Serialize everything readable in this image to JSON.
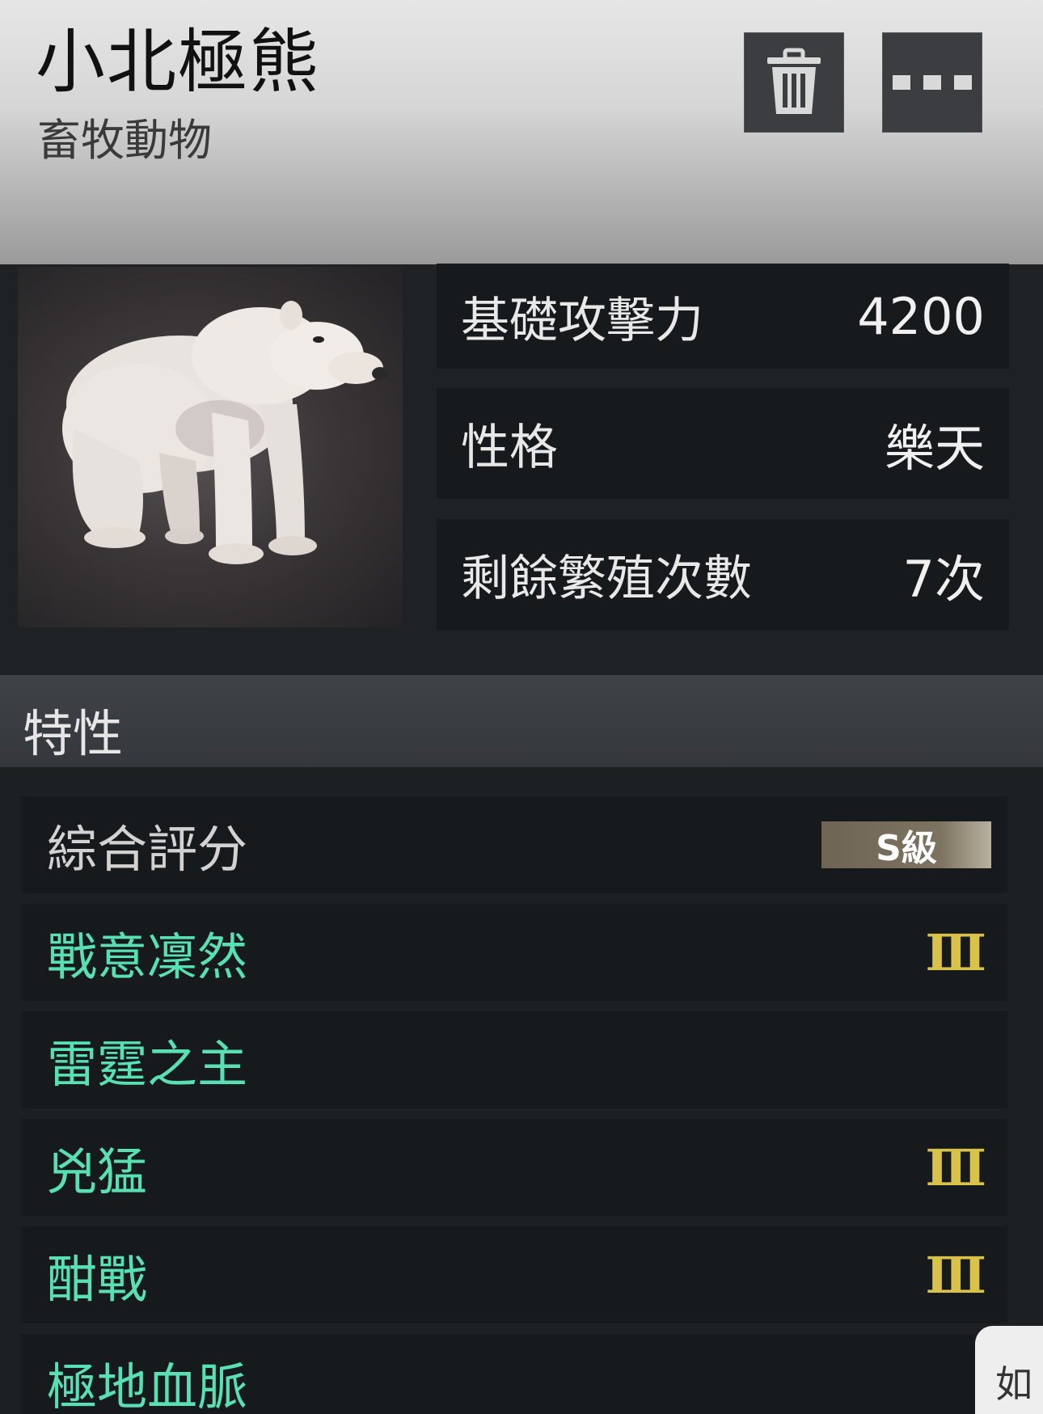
{
  "header": {
    "title": "小北極熊",
    "subtitle": "畜牧動物",
    "delete_icon": "trash-icon",
    "more_icon": "more-dots-icon"
  },
  "stats": [
    {
      "label": "基礎攻擊力",
      "value": "4200"
    },
    {
      "label": "性格",
      "value": "樂天"
    },
    {
      "label": "剩餘繁殖次數",
      "value": "7次"
    }
  ],
  "traits_section": {
    "title": "特性",
    "score": {
      "label": "綜合評分",
      "grade": "S級"
    },
    "items": [
      {
        "name": "戰意凜然",
        "tier": "Ⅲ"
      },
      {
        "name": "雷霆之主",
        "tier": ""
      },
      {
        "name": "兇猛",
        "tier": "Ⅲ"
      },
      {
        "name": "酣戰",
        "tier": "Ⅲ"
      },
      {
        "name": "極地血脈",
        "tier": ""
      }
    ]
  },
  "floating_tab": {
    "label": "如"
  },
  "colors": {
    "trait_green": "#58e0b2",
    "tier_gold": "#d8c24a",
    "panel_dark": "#171a1d",
    "background": "#1d2023"
  }
}
